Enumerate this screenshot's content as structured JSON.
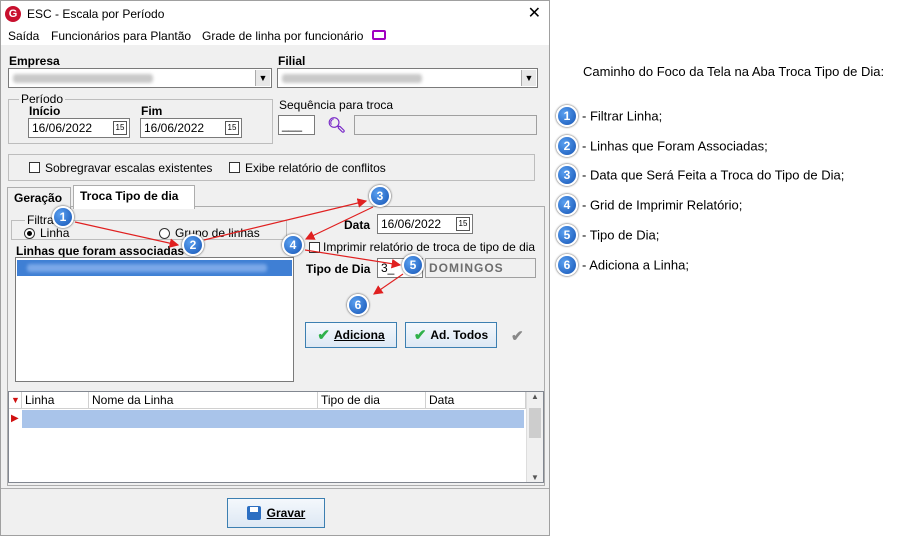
{
  "window": {
    "title": "ESC - Escala por Período",
    "close": "✕"
  },
  "menu": {
    "items": [
      "Saída",
      "Funcionários para Plantão",
      "Grade de linha por funcionário"
    ]
  },
  "empresa": {
    "label": "Empresa"
  },
  "filial": {
    "label": "Filial"
  },
  "periodo": {
    "label": "Período",
    "inicio_label": "Início",
    "inicio_value": "16/06/2022",
    "fim_label": "Fim",
    "fim_value": "16/06/2022"
  },
  "sequencia": {
    "label": "Sequência para troca",
    "value": "___"
  },
  "options": {
    "sobregravar": "Sobregravar escalas existentes",
    "exibe": "Exibe relatório de conflitos"
  },
  "tabs": [
    {
      "label": "Geração"
    },
    {
      "label": "Troca Tipo de dia"
    }
  ],
  "filtrar": {
    "label": "Filtrar",
    "opt1": "Linha",
    "opt2": "Grupo de linhas"
  },
  "linhas_label": "Linhas que foram associadas",
  "data": {
    "label": "Data",
    "value": "16/06/2022"
  },
  "imprimir": {
    "label": "Imprimir relatório de troca de tipo de dia"
  },
  "tipo_dia": {
    "label": "Tipo de Dia",
    "code": "3_",
    "value": "DOMINGOS"
  },
  "buttons": {
    "adiciona": "Adiciona",
    "ad_todos": "Ad. Todos",
    "gravar": "Gravar"
  },
  "grid": {
    "columns": [
      "Linha",
      "Nome da Linha",
      "Tipo de dia",
      "Data"
    ]
  },
  "legend": {
    "title": "Caminho do Foco da Tela na Aba Troca Tipo de Dia:",
    "items": [
      {
        "n": "1",
        "text": "- Filtrar Linha;"
      },
      {
        "n": "2",
        "text": "- Linhas que Foram Associadas;"
      },
      {
        "n": "3",
        "text": "- Data que Será Feita a Troca do Tipo de Dia;"
      },
      {
        "n": "4",
        "text": "- Grid de Imprimir Relatório;"
      },
      {
        "n": "5",
        "text": "- Tipo de Dia;"
      },
      {
        "n": "6",
        "text": "- Adiciona a Linha;"
      }
    ]
  },
  "colors": {
    "marker": "#1554b5",
    "arrow": "#e02020",
    "selection": "#3f7fd4",
    "grid_row": "#a9c4ea"
  }
}
